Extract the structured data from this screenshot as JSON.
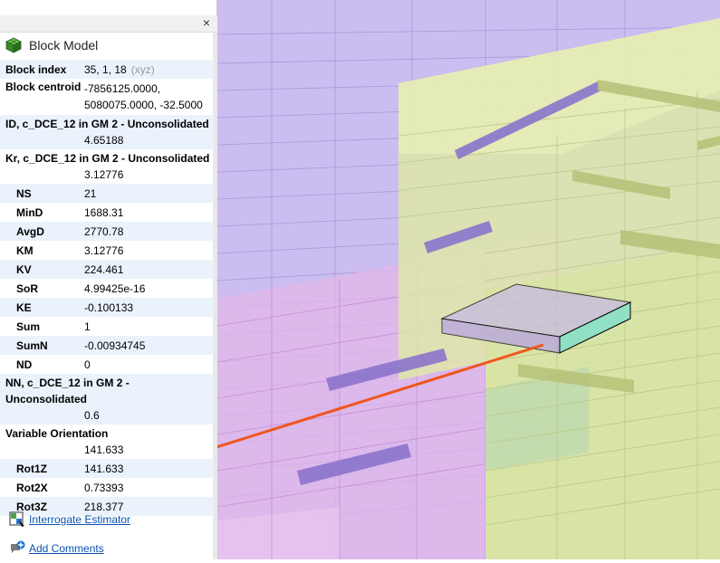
{
  "panel": {
    "close_glyph": "×",
    "title": "Block Model",
    "title_icon": "block-model-cube-icon",
    "block_index": {
      "label": "Block index",
      "value": "35, 1, 18",
      "suffix": "(xyz)"
    },
    "block_centroid": {
      "label": "Block centroid",
      "value_line1": "-7856125.0000,",
      "value_line2": "5080075.0000, -32.5000"
    },
    "id_attr": {
      "label": "ID, c_DCE_12 in GM 2 - Unconsolidated",
      "value": "4.65188"
    },
    "kr_attr": {
      "label": "Kr, c_DCE_12 in GM 2 - Unconsolidated",
      "value": "3.12776"
    },
    "stats": [
      {
        "label": "NS",
        "value": "21"
      },
      {
        "label": "MinD",
        "value": "1688.31"
      },
      {
        "label": "AvgD",
        "value": "2770.78"
      },
      {
        "label": "KM",
        "value": "3.12776"
      },
      {
        "label": "KV",
        "value": "224.461"
      },
      {
        "label": "SoR",
        "value": "4.99425e-16"
      },
      {
        "label": "KE",
        "value": "-0.100133"
      },
      {
        "label": "Sum",
        "value": "1"
      },
      {
        "label": "SumN",
        "value": "-0.00934745"
      },
      {
        "label": "ND",
        "value": "0"
      }
    ],
    "nn_attr": {
      "label": "NN, c_DCE_12 in GM 2 - Unconsolidated",
      "value": "0.6"
    },
    "variable_orientation": {
      "label": "Variable Orientation",
      "value": "141.633"
    },
    "rotations": [
      {
        "label": "Rot1Z",
        "value": "141.633"
      },
      {
        "label": "Rot2X",
        "value": "0.73393"
      },
      {
        "label": "Rot3Z",
        "value": "218.377"
      }
    ],
    "links": {
      "interrogate": {
        "label": "Interrogate Estimator",
        "icon": "interrogate-estimator-icon"
      },
      "comments": {
        "label": "Add Comments",
        "icon": "add-comment-icon"
      }
    }
  },
  "viewport": {
    "colors": {
      "purple": "#b9a6ea",
      "violet_bar": "#8a74cc",
      "lime": "#e0eba8",
      "pink": "#dfb1e6",
      "teal": "#8ed8c0",
      "arrow": "#f0561d"
    }
  }
}
